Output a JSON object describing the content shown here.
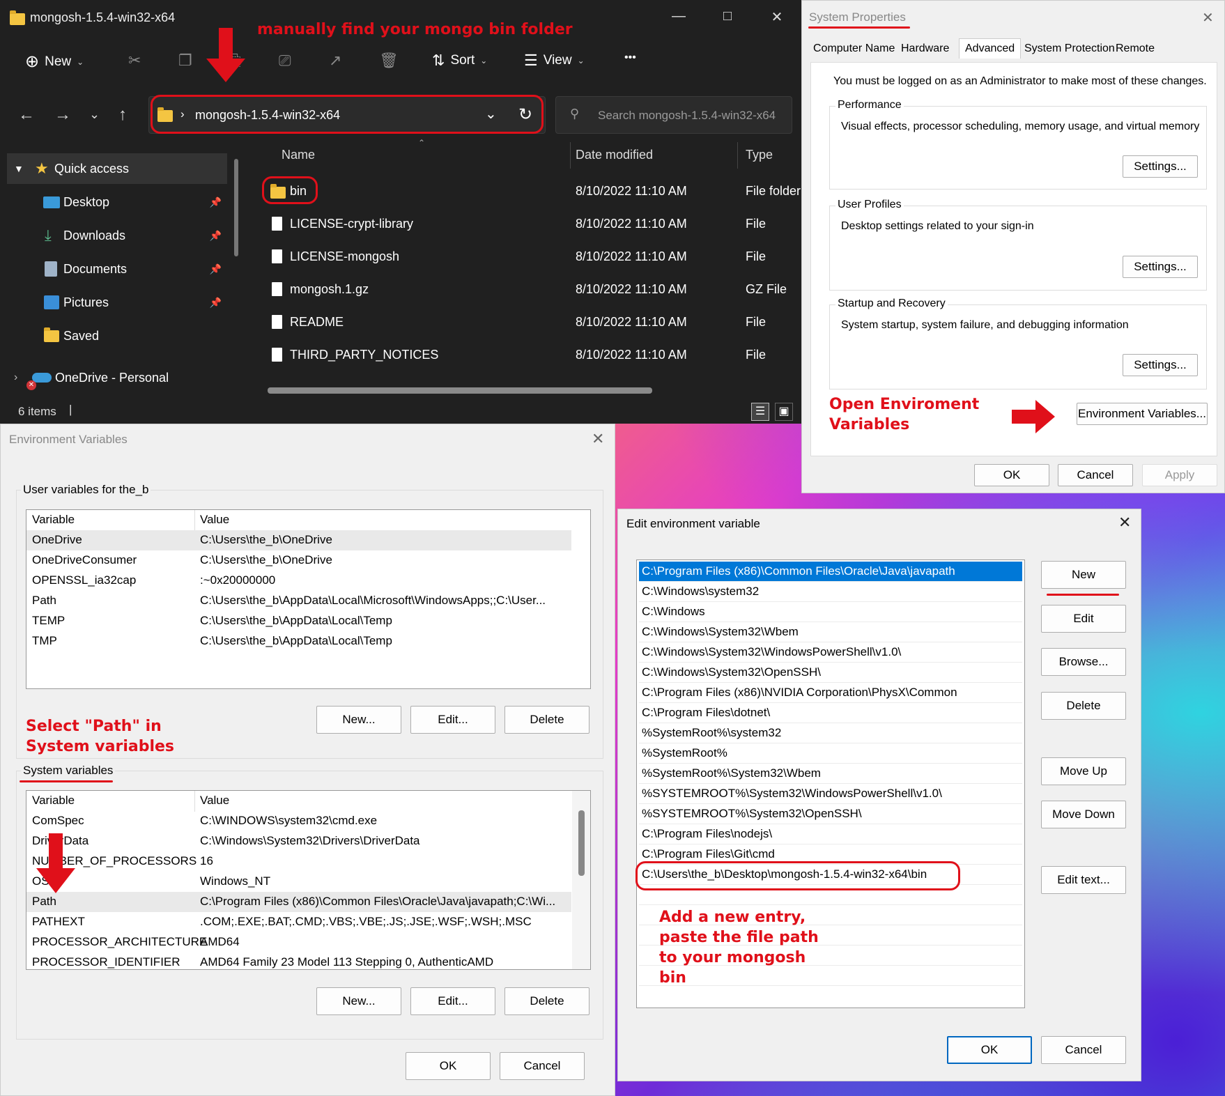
{
  "explorer": {
    "title": "mongosh-1.5.4-win32-x64",
    "toolbar": {
      "new": "New",
      "sort": "Sort",
      "view": "View",
      "more": "•••"
    },
    "address": "mongosh-1.5.4-win32-x64",
    "search_placeholder": "Search mongosh-1.5.4-win32-x64",
    "sidebar": [
      {
        "label": "Quick access",
        "icon": "star-icon"
      },
      {
        "label": "Desktop",
        "icon": "desktop-icon"
      },
      {
        "label": "Downloads",
        "icon": "download-icon"
      },
      {
        "label": "Documents",
        "icon": "documents-icon"
      },
      {
        "label": "Pictures",
        "icon": "pictures-icon"
      },
      {
        "label": "Saved",
        "icon": "folder-icon"
      },
      {
        "label": "OneDrive - Personal",
        "icon": "onedrive-icon"
      }
    ],
    "columns": {
      "name": "Name",
      "date": "Date modified",
      "type": "Type"
    },
    "files": [
      {
        "name": "bin",
        "date": "8/10/2022 11:10 AM",
        "type": "File folder"
      },
      {
        "name": "LICENSE-crypt-library",
        "date": "8/10/2022 11:10 AM",
        "type": "File"
      },
      {
        "name": "LICENSE-mongosh",
        "date": "8/10/2022 11:10 AM",
        "type": "File"
      },
      {
        "name": "mongosh.1.gz",
        "date": "8/10/2022 11:10 AM",
        "type": "GZ File"
      },
      {
        "name": "README",
        "date": "8/10/2022 11:10 AM",
        "type": "File"
      },
      {
        "name": "THIRD_PARTY_NOTICES",
        "date": "8/10/2022 11:10 AM",
        "type": "File"
      }
    ],
    "status": "6 items"
  },
  "sysprops": {
    "title": "System Properties",
    "tabs": [
      "Computer Name",
      "Hardware",
      "Advanced",
      "System Protection",
      "Remote"
    ],
    "admin_note": "You must be logged on as an Administrator to make most of these changes.",
    "groups": [
      {
        "label": "Performance",
        "desc": "Visual effects, processor scheduling, memory usage, and virtual memory",
        "button": "Settings..."
      },
      {
        "label": "User Profiles",
        "desc": "Desktop settings related to your sign-in",
        "button": "Settings..."
      },
      {
        "label": "Startup and Recovery",
        "desc": "System startup, system failure, and debugging information",
        "button": "Settings..."
      }
    ],
    "env_button": "Environment Variables...",
    "ok": "OK",
    "cancel": "Cancel",
    "apply": "Apply"
  },
  "envvars": {
    "title": "Environment Variables",
    "user_label": "User variables for the_b",
    "system_label": "System variables",
    "col_variable": "Variable",
    "col_value": "Value",
    "user_vars": [
      {
        "name": "OneDrive",
        "value": "C:\\Users\\the_b\\OneDrive"
      },
      {
        "name": "OneDriveConsumer",
        "value": "C:\\Users\\the_b\\OneDrive"
      },
      {
        "name": "OPENSSL_ia32cap",
        "value": ":~0x20000000"
      },
      {
        "name": "Path",
        "value": "C:\\Users\\the_b\\AppData\\Local\\Microsoft\\WindowsApps;;C:\\User..."
      },
      {
        "name": "TEMP",
        "value": "C:\\Users\\the_b\\AppData\\Local\\Temp"
      },
      {
        "name": "TMP",
        "value": "C:\\Users\\the_b\\AppData\\Local\\Temp"
      }
    ],
    "system_vars": [
      {
        "name": "ComSpec",
        "value": "C:\\WINDOWS\\system32\\cmd.exe"
      },
      {
        "name": "DriverData",
        "value": "C:\\Windows\\System32\\Drivers\\DriverData"
      },
      {
        "name": "NUMBER_OF_PROCESSORS",
        "value": "16"
      },
      {
        "name": "OS",
        "value": "Windows_NT"
      },
      {
        "name": "Path",
        "value": "C:\\Program Files (x86)\\Common Files\\Oracle\\Java\\javapath;C:\\Wi..."
      },
      {
        "name": "PATHEXT",
        "value": ".COM;.EXE;.BAT;.CMD;.VBS;.VBE;.JS;.JSE;.WSF;.WSH;.MSC"
      },
      {
        "name": "PROCESSOR_ARCHITECTURE",
        "value": "AMD64"
      },
      {
        "name": "PROCESSOR_IDENTIFIER",
        "value": "AMD64 Family 23 Model 113 Stepping 0, AuthenticAMD"
      }
    ],
    "btn_new": "New...",
    "btn_edit": "Edit...",
    "btn_delete": "Delete",
    "ok": "OK",
    "cancel": "Cancel"
  },
  "editenv": {
    "title": "Edit environment variable",
    "entries": [
      "C:\\Program Files (x86)\\Common Files\\Oracle\\Java\\javapath",
      "C:\\Windows\\system32",
      "C:\\Windows",
      "C:\\Windows\\System32\\Wbem",
      "C:\\Windows\\System32\\WindowsPowerShell\\v1.0\\",
      "C:\\Windows\\System32\\OpenSSH\\",
      "C:\\Program Files (x86)\\NVIDIA Corporation\\PhysX\\Common",
      "C:\\Program Files\\dotnet\\",
      "%SystemRoot%\\system32",
      "%SystemRoot%",
      "%SystemRoot%\\System32\\Wbem",
      "%SYSTEMROOT%\\System32\\WindowsPowerShell\\v1.0\\",
      "%SYSTEMROOT%\\System32\\OpenSSH\\",
      "C:\\Program Files\\nodejs\\",
      "C:\\Program Files\\Git\\cmd",
      "C:\\Users\\the_b\\Desktop\\mongosh-1.5.4-win32-x64\\bin"
    ],
    "buttons": {
      "new": "New",
      "edit": "Edit",
      "browse": "Browse...",
      "delete": "Delete",
      "move_up": "Move Up",
      "move_down": "Move Down",
      "edit_text": "Edit text..."
    },
    "ok": "OK",
    "cancel": "Cancel"
  },
  "annotations": {
    "find_bin": "manually find your mongo bin folder",
    "open_env": [
      "Open Enviroment",
      "Variables"
    ],
    "select_path": [
      "Select \"Path\" in",
      "System variables"
    ],
    "add_entry": [
      "Add a new entry,",
      "paste the file path",
      "to your mongosh",
      "bin"
    ],
    "accent": "#e0101a"
  }
}
